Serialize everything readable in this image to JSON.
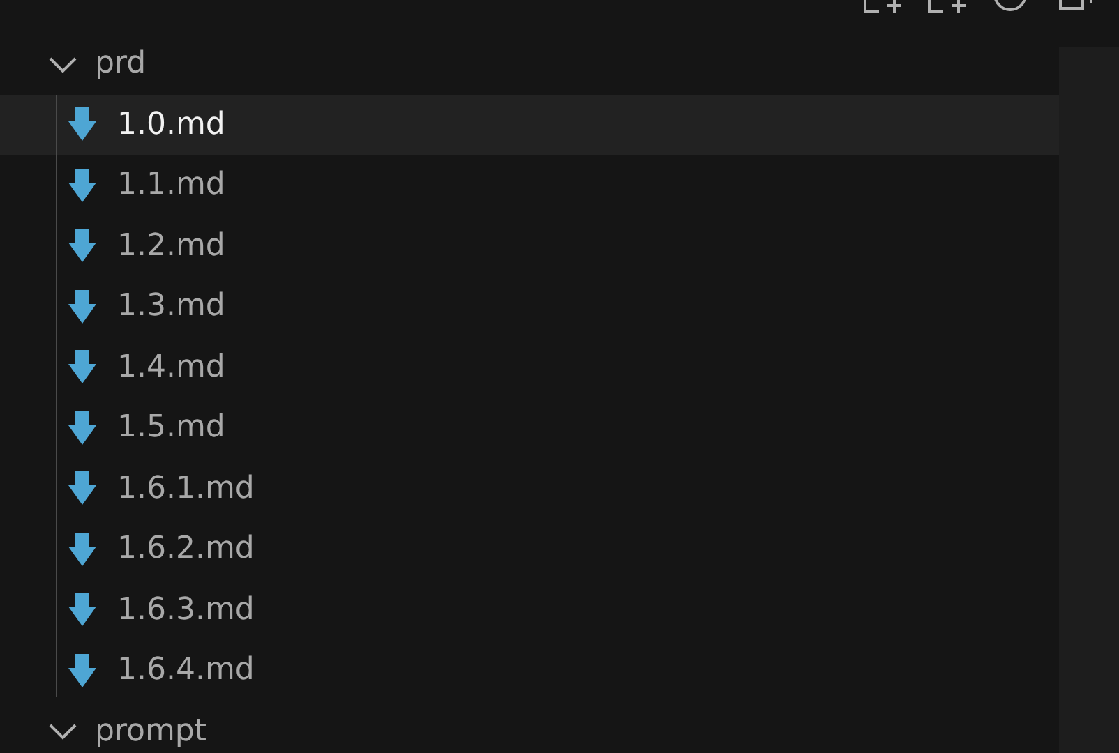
{
  "tree": [
    {
      "name": "prd",
      "expanded": true,
      "children": [
        {
          "name": "1.0.md",
          "selected": true
        },
        {
          "name": "1.1.md",
          "selected": false
        },
        {
          "name": "1.2.md",
          "selected": false
        },
        {
          "name": "1.3.md",
          "selected": false
        },
        {
          "name": "1.4.md",
          "selected": false
        },
        {
          "name": "1.5.md",
          "selected": false
        },
        {
          "name": "1.6.1.md",
          "selected": false
        },
        {
          "name": "1.6.2.md",
          "selected": false
        },
        {
          "name": "1.6.3.md",
          "selected": false
        },
        {
          "name": "1.6.4.md",
          "selected": false
        }
      ]
    },
    {
      "name": "prompt",
      "expanded": true
    }
  ]
}
